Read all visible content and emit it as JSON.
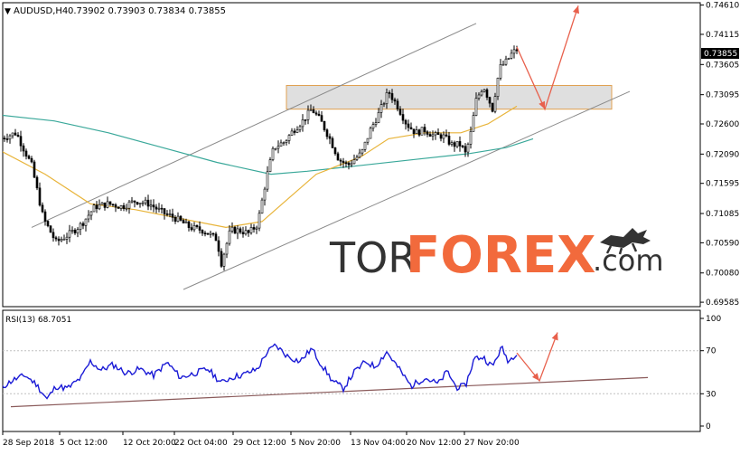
{
  "chart_data": {
    "type": "candlestick",
    "symbol_header": "AUDUSD,H4",
    "ohlc_header": "0.73902 0.73903 0.73834 0.73855",
    "current_price_label": "0.73855",
    "price_axis": {
      "ylim": [
        0.6951,
        0.7465
      ],
      "tick_labels": [
        "0.74610",
        "0.74115",
        "0.73605",
        "0.73095",
        "0.72600",
        "0.72090",
        "0.71595",
        "0.71085",
        "0.70590",
        "0.70080",
        "0.69585"
      ]
    },
    "x_axis": {
      "tick_labels": [
        "28 Sep 2018",
        "5 Oct 12:00",
        "12 Oct 20:00",
        "22 Oct 04:00",
        "29 Oct 12:00",
        "5 Nov 20:00",
        "13 Nov 04:00",
        "20 Nov 12:00",
        "27 Nov 20:00"
      ]
    },
    "price_keypoints": [
      [
        0,
        0.7235
      ],
      [
        18,
        0.7245
      ],
      [
        24,
        0.7225
      ],
      [
        35,
        0.719
      ],
      [
        48,
        0.71
      ],
      [
        62,
        0.706
      ],
      [
        78,
        0.7075
      ],
      [
        90,
        0.709
      ],
      [
        105,
        0.712
      ],
      [
        120,
        0.7125
      ],
      [
        135,
        0.712
      ],
      [
        150,
        0.713
      ],
      [
        165,
        0.7125
      ],
      [
        180,
        0.711
      ],
      [
        195,
        0.71
      ],
      [
        210,
        0.7085
      ],
      [
        225,
        0.708
      ],
      [
        240,
        0.7065
      ],
      [
        245,
        0.7025
      ],
      [
        255,
        0.708
      ],
      [
        265,
        0.708
      ],
      [
        275,
        0.7075
      ],
      [
        285,
        0.709
      ],
      [
        295,
        0.717
      ],
      [
        303,
        0.722
      ],
      [
        315,
        0.723
      ],
      [
        325,
        0.725
      ],
      [
        335,
        0.7265
      ],
      [
        345,
        0.7285
      ],
      [
        355,
        0.7265
      ],
      [
        365,
        0.7235
      ],
      [
        375,
        0.72
      ],
      [
        385,
        0.719
      ],
      [
        392,
        0.72
      ],
      [
        400,
        0.721
      ],
      [
        410,
        0.725
      ],
      [
        420,
        0.728
      ],
      [
        430,
        0.7315
      ],
      [
        440,
        0.729
      ],
      [
        450,
        0.726
      ],
      [
        460,
        0.7245
      ],
      [
        470,
        0.725
      ],
      [
        480,
        0.724
      ],
      [
        490,
        0.724
      ],
      [
        500,
        0.7225
      ],
      [
        510,
        0.7225
      ],
      [
        515,
        0.721
      ],
      [
        520,
        0.7235
      ],
      [
        527,
        0.73
      ],
      [
        535,
        0.7325
      ],
      [
        545,
        0.7285
      ],
      [
        553,
        0.7355
      ],
      [
        560,
        0.7365
      ],
      [
        567,
        0.738
      ],
      [
        572,
        0.73855
      ]
    ],
    "ema_fast_keypoints": [
      [
        0,
        0.7215
      ],
      [
        50,
        0.7175
      ],
      [
        100,
        0.7125
      ],
      [
        150,
        0.7115
      ],
      [
        200,
        0.71
      ],
      [
        250,
        0.7085
      ],
      [
        290,
        0.7095
      ],
      [
        320,
        0.7135
      ],
      [
        350,
        0.7175
      ],
      [
        400,
        0.7205
      ],
      [
        430,
        0.7235
      ],
      [
        470,
        0.7245
      ],
      [
        510,
        0.7245
      ],
      [
        540,
        0.726
      ],
      [
        572,
        0.729
      ]
    ],
    "ema_slow_keypoints": [
      [
        0,
        0.7275
      ],
      [
        60,
        0.7265
      ],
      [
        120,
        0.7245
      ],
      [
        180,
        0.722
      ],
      [
        240,
        0.7195
      ],
      [
        300,
        0.7175
      ],
      [
        340,
        0.718
      ],
      [
        400,
        0.719
      ],
      [
        460,
        0.72
      ],
      [
        520,
        0.721
      ],
      [
        560,
        0.722
      ],
      [
        590,
        0.7235
      ]
    ],
    "channel_upper": [
      [
        35,
        0.7085
      ],
      [
        527,
        0.743
      ]
    ],
    "channel_lower": [
      [
        203,
        0.698
      ],
      [
        697,
        0.7315
      ]
    ],
    "resistance_zone": {
      "x": [
        317,
        677
      ],
      "y": [
        0.7285,
        0.7325
      ]
    },
    "forecast_arrow_price": [
      [
        572,
        0.739
      ],
      [
        603,
        0.7285
      ],
      [
        640,
        0.746
      ]
    ],
    "rsi": {
      "label": "RSI(13) 68.7051",
      "ylim": [
        0,
        100
      ],
      "tick_labels": [
        "100",
        "70",
        "30",
        "0"
      ],
      "keypoints": [
        [
          0,
          35
        ],
        [
          15,
          43
        ],
        [
          28,
          47
        ],
        [
          40,
          39
        ],
        [
          52,
          25
        ],
        [
          62,
          37
        ],
        [
          75,
          35
        ],
        [
          90,
          45
        ],
        [
          100,
          60
        ],
        [
          112,
          52
        ],
        [
          125,
          57
        ],
        [
          140,
          49
        ],
        [
          155,
          53
        ],
        [
          170,
          47
        ],
        [
          185,
          59
        ],
        [
          200,
          45
        ],
        [
          215,
          49
        ],
        [
          230,
          53
        ],
        [
          245,
          40
        ],
        [
          255,
          45
        ],
        [
          270,
          48
        ],
        [
          285,
          53
        ],
        [
          295,
          68
        ],
        [
          305,
          75
        ],
        [
          318,
          65
        ],
        [
          332,
          60
        ],
        [
          345,
          72
        ],
        [
          355,
          58
        ],
        [
          368,
          42
        ],
        [
          380,
          35
        ],
        [
          392,
          50
        ],
        [
          405,
          60
        ],
        [
          415,
          55
        ],
        [
          428,
          69
        ],
        [
          440,
          55
        ],
        [
          455,
          37
        ],
        [
          470,
          45
        ],
        [
          485,
          39
        ],
        [
          495,
          51
        ],
        [
          505,
          36
        ],
        [
          515,
          37
        ],
        [
          525,
          63
        ],
        [
          535,
          64
        ],
        [
          545,
          55
        ],
        [
          555,
          73
        ],
        [
          563,
          60
        ],
        [
          572,
          68.7
        ]
      ],
      "trendline": [
        [
          12,
          18
        ],
        [
          717,
          45
        ]
      ],
      "forecast_arrow": [
        [
          572,
          68
        ],
        [
          597,
          42
        ],
        [
          617,
          87
        ]
      ]
    },
    "watermark_text": {
      "prefix": "TOR",
      "main": "FOREX",
      "suffix": ".com"
    },
    "colors": {
      "candle": "#000000",
      "ema_fast": "#e8b43a",
      "ema_slow": "#3aa89a",
      "channel": "#8a8a8a",
      "zone_fill": "#d9d9d9",
      "zone_border": "#e0a050",
      "forecast_arrow": "#e8604c",
      "rsi_line": "#1a1ad6",
      "rsi_trendline": "#8a5a5a",
      "watermark_dark": "#333333",
      "watermark_accent": "#f26a3c"
    }
  }
}
